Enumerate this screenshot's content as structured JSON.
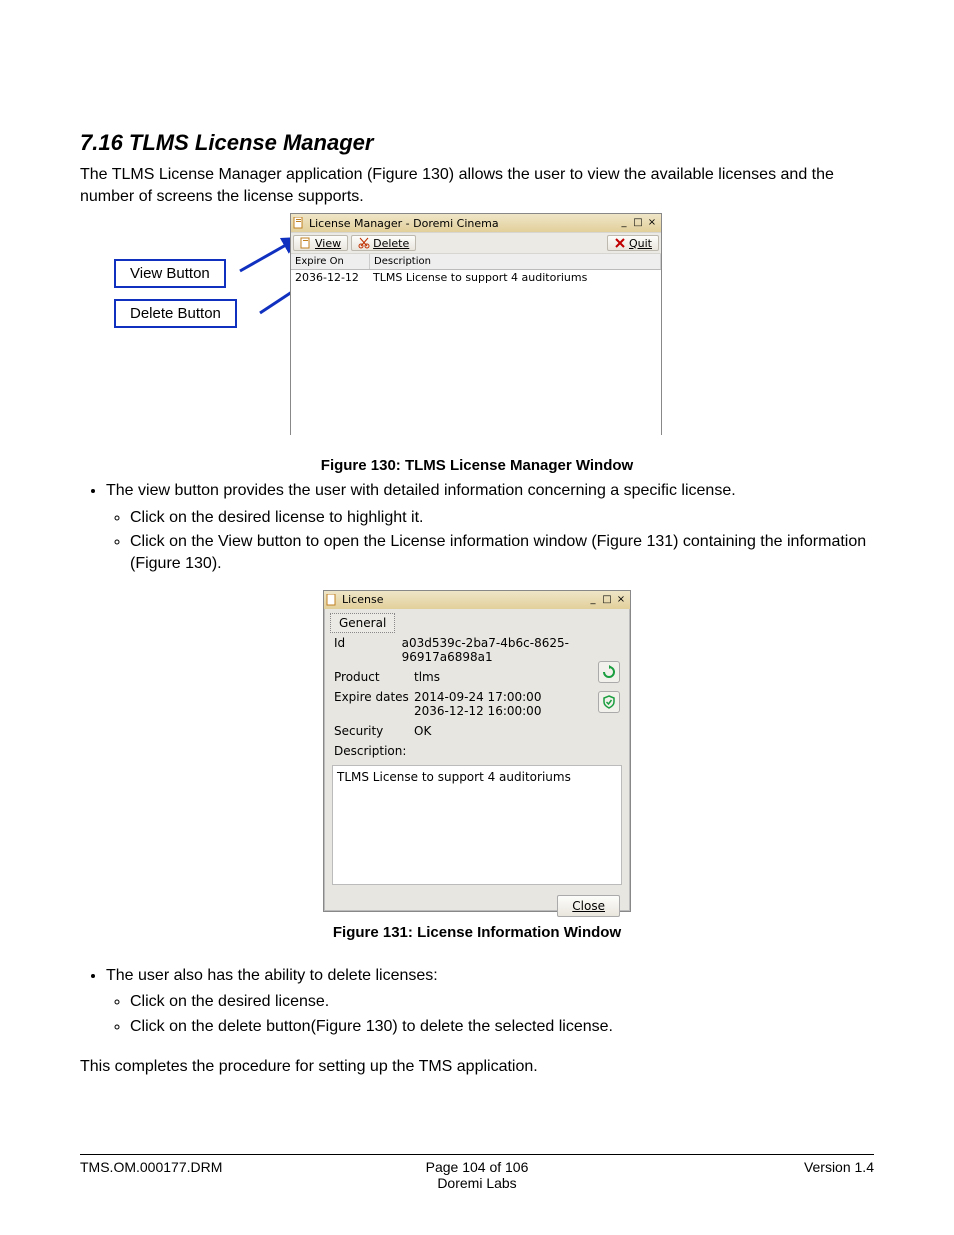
{
  "heading": "7.16 TLMS License Manager",
  "intro": "The TLMS License Manager application (Figure 130) allows the user to view the available licenses and the number of screens the license supports.",
  "callouts": {
    "view": "View Button",
    "delete": "Delete Button"
  },
  "fig130": {
    "title": "License Manager - Doremi Cinema",
    "toolbar": {
      "view": "View",
      "delete": "Delete",
      "quit": "Quit"
    },
    "columns": {
      "expire": "Expire On",
      "desc": "Description"
    },
    "row": {
      "expire": "2036-12-12",
      "desc": "TLMS License to support 4 auditoriums"
    },
    "caption": "Figure 130: TLMS License Manager Window"
  },
  "bullets1": {
    "a": "The view button provides the user with detailed information concerning a specific license.",
    "a1": "Click on the desired license to highlight it.",
    "a2": "Click on the View button to open the License information window (Figure 131) containing the information (Figure 130)."
  },
  "fig131": {
    "title": "License",
    "tab": "General",
    "labels": {
      "id": "Id",
      "product": "Product",
      "expire": "Expire dates",
      "security": "Security",
      "description": "Description:"
    },
    "values": {
      "id": "a03d539c-2ba7-4b6c-8625-96917a6898a1",
      "product": "tlms",
      "expire1": "2014-09-24 17:00:00",
      "expire2": "2036-12-12 16:00:00",
      "security": "OK",
      "description": "TLMS License to support 4 auditoriums"
    },
    "close": "Close",
    "caption": "Figure 131: License Information Window"
  },
  "bullets2": {
    "a": "The user also has the ability to delete licenses:",
    "a1": "Click on the desired license.",
    "a2": "Click on the delete button(Figure 130) to delete the selected license."
  },
  "outro": "This completes the procedure for setting up the TMS application.",
  "footer": {
    "left": "TMS.OM.000177.DRM",
    "center1": "Page 104 of 106",
    "center2": "Doremi Labs",
    "right": "Version 1.4"
  }
}
